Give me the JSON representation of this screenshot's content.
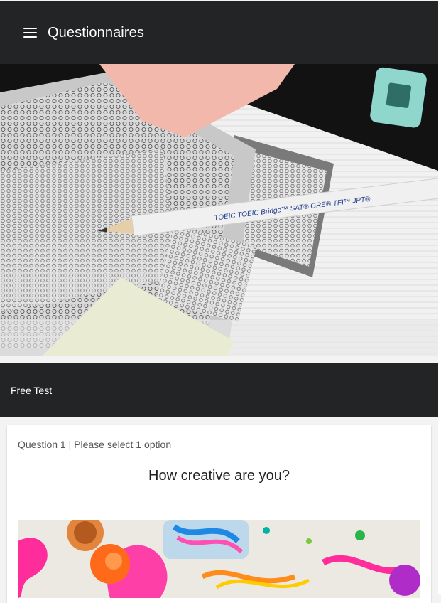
{
  "app_bar": {
    "title": "Questionnaires",
    "menu_icon": "menu-icon"
  },
  "hero": {
    "image": "answer-sheet-photo",
    "pencil_text": "TOEIC   TOEIC Bridge™   SAT®   GRE®   TFI™   JPT®"
  },
  "test": {
    "name": "Free Test"
  },
  "question": {
    "meta": "Question 1 | Please select 1 option",
    "text": "How creative are you?",
    "image": "paint-splash-photo"
  },
  "colors": {
    "app_bar": "#232426",
    "background": "#f3f3f4",
    "card": "#ffffff"
  }
}
